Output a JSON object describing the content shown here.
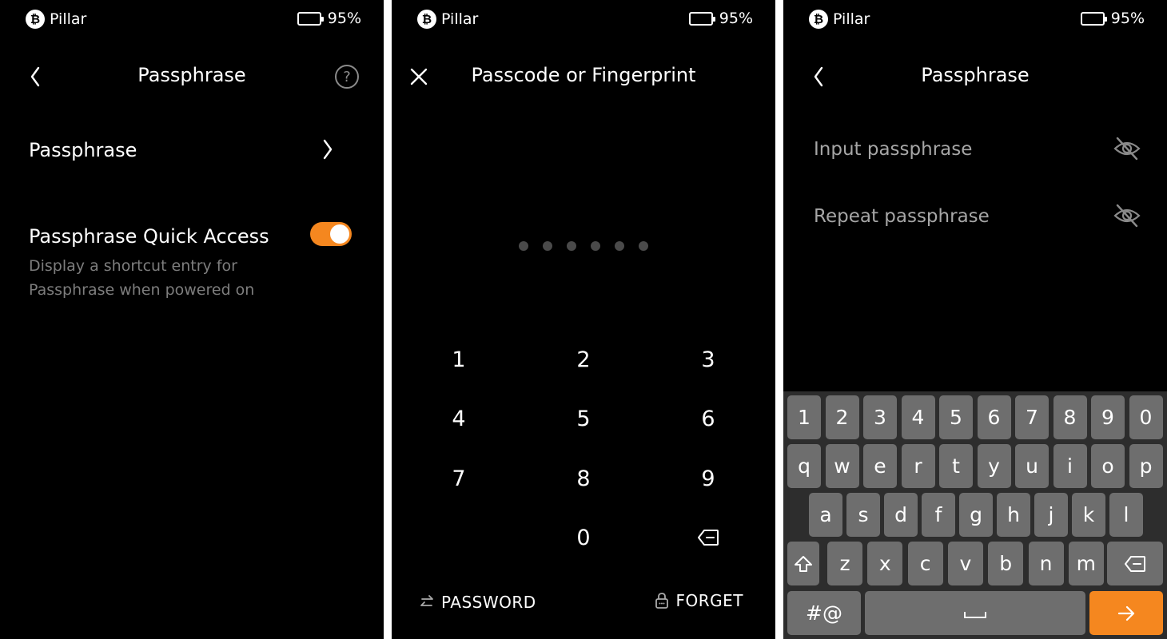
{
  "status_bar": {
    "brand": "Pillar",
    "battery": "95%",
    "battery_level": 0.95
  },
  "screen1": {
    "title": "Passphrase",
    "menu_item": "Passphrase",
    "quick_access": {
      "title": "Passphrase Quick Access",
      "description": "Display a shortcut entry for Passphrase when powered on",
      "enabled": true
    },
    "icons": {
      "back": "chevron-left-icon",
      "help": "help-circle-icon"
    }
  },
  "screen2": {
    "title": "Passcode or Fingerprint",
    "pin_length": 6,
    "keys": [
      "1",
      "2",
      "3",
      "4",
      "5",
      "6",
      "7",
      "8",
      "9",
      "0"
    ],
    "password_label": "PASSWORD",
    "forget_label": "FORGET",
    "icons": {
      "close": "close-icon",
      "backspace": "backspace-icon",
      "switch": "switch-arrows-icon",
      "lock": "lock-icon"
    }
  },
  "screen3": {
    "title": "Passphrase",
    "input_placeholder": "Input passphrase",
    "repeat_placeholder": "Repeat passphrase",
    "keyboard": {
      "row_numbers": [
        "1",
        "2",
        "3",
        "4",
        "5",
        "6",
        "7",
        "8",
        "9",
        "0"
      ],
      "row_1": [
        "q",
        "w",
        "e",
        "r",
        "t",
        "y",
        "u",
        "i",
        "o",
        "p"
      ],
      "row_2": [
        "a",
        "s",
        "d",
        "f",
        "g",
        "h",
        "j",
        "k",
        "l"
      ],
      "row_3": [
        "z",
        "x",
        "c",
        "v",
        "b",
        "n",
        "m"
      ],
      "symbols_label": "#@"
    },
    "icons": {
      "visibility": "eye-off-icon",
      "shift": "shift-icon",
      "space": "space-icon",
      "enter": "arrow-right-icon"
    }
  },
  "colors": {
    "accent": "#f5871f",
    "background": "#000000",
    "key": "#6e6e6e",
    "keyboard_bg": "#2d2d2d",
    "muted_text": "#7d7d7d"
  }
}
